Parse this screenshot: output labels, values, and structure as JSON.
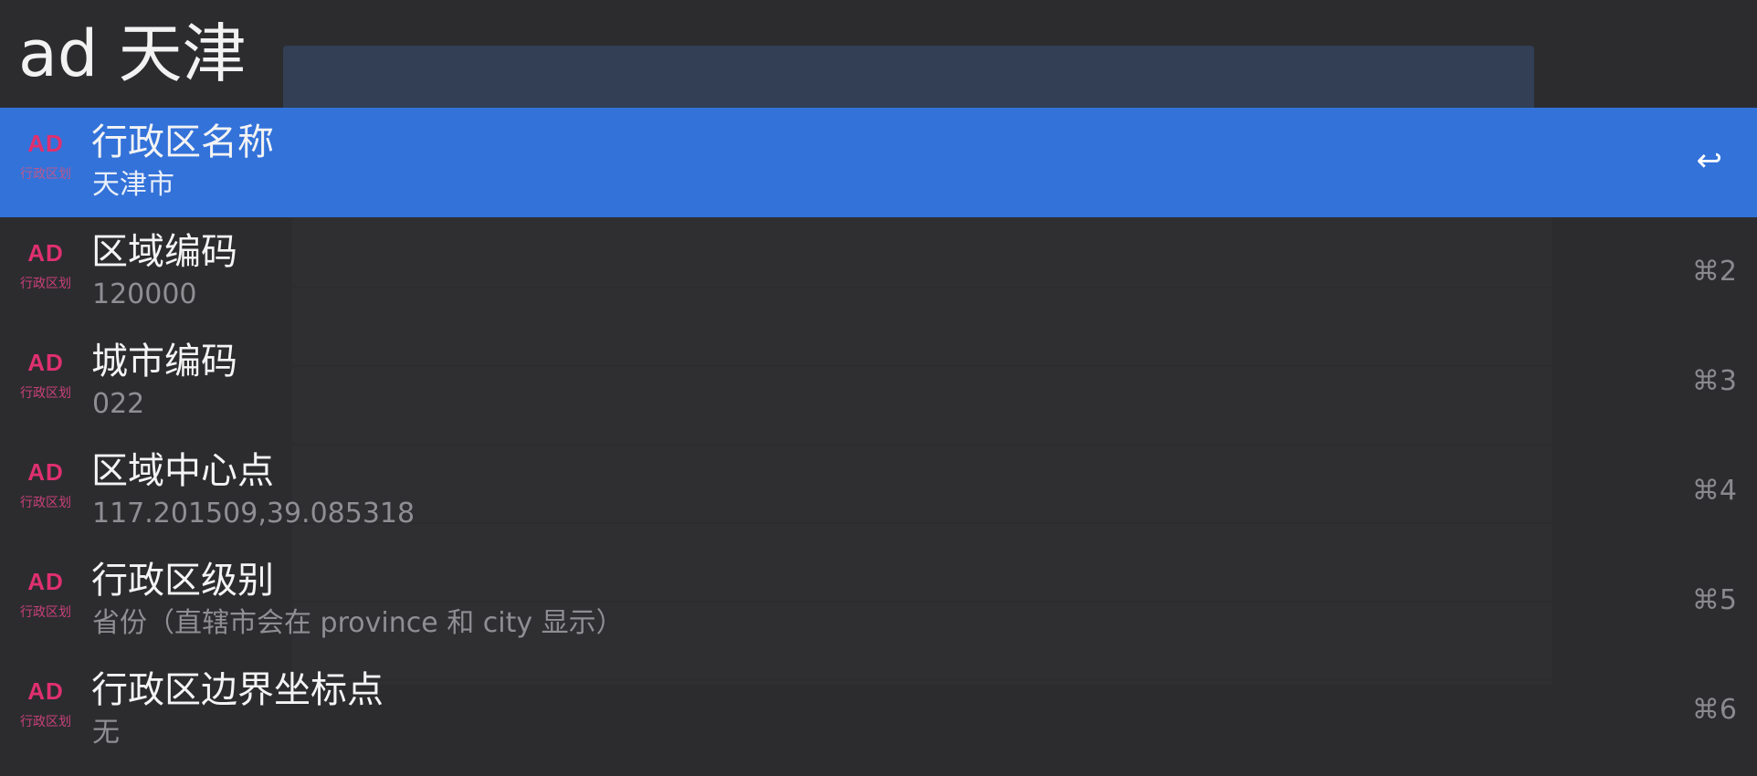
{
  "search": {
    "query": "ad 天津"
  },
  "results": [
    {
      "icon": "AD",
      "icon_sub": "行政区划",
      "title": "行政区名称",
      "subtitle": "天津市",
      "shortcut": "↩",
      "selected": true
    },
    {
      "icon": "AD",
      "icon_sub": "行政区划",
      "title": "区域编码",
      "subtitle": "120000",
      "shortcut": "⌘2",
      "selected": false
    },
    {
      "icon": "AD",
      "icon_sub": "行政区划",
      "title": "城市编码",
      "subtitle": "022",
      "shortcut": "⌘3",
      "selected": false
    },
    {
      "icon": "AD",
      "icon_sub": "行政区划",
      "title": "区域中心点",
      "subtitle": "117.201509,39.085318",
      "shortcut": "⌘4",
      "selected": false
    },
    {
      "icon": "AD",
      "icon_sub": "行政区划",
      "title": "行政区级别",
      "subtitle": "省份（直辖市会在 province 和 city 显示）",
      "shortcut": "⌘5",
      "selected": false
    },
    {
      "icon": "AD",
      "icon_sub": "行政区划",
      "title": "行政区边界坐标点",
      "subtitle": "无",
      "shortcut": "⌘6",
      "selected": false
    }
  ],
  "colors": {
    "background": "#2c2c2f",
    "selection": "#3372d9",
    "icon_accent": "#e0306e",
    "title_text": "#f4f4f4",
    "subtitle_text": "#8f8f93"
  }
}
